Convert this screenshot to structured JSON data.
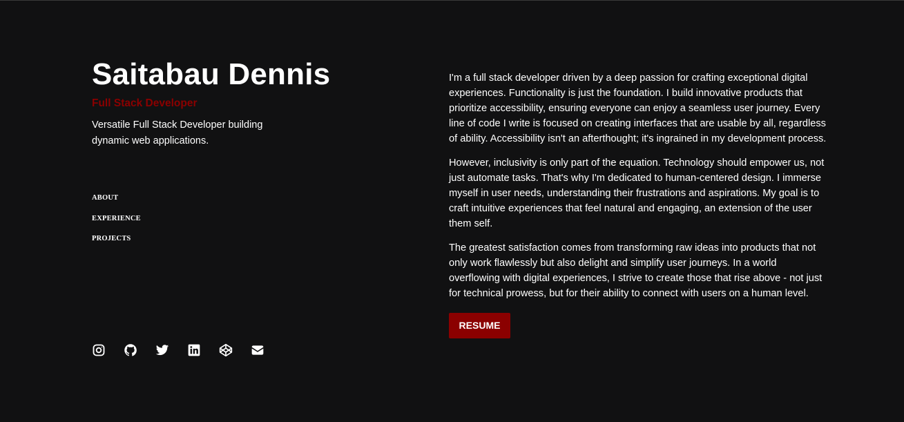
{
  "header": {
    "name": "Saitabau Dennis",
    "role": "Full Stack Developer",
    "tagline": "Versatile Full Stack Developer building dynamic web applications."
  },
  "nav": {
    "items": [
      {
        "label": "ABOUT"
      },
      {
        "label": "EXPERIENCE"
      },
      {
        "label": "PROJECTS"
      }
    ]
  },
  "socials": {
    "icons": [
      "instagram-icon",
      "github-icon",
      "twitter-icon",
      "linkedin-icon",
      "codepen-icon",
      "mail-icon"
    ]
  },
  "about": {
    "paragraphs": [
      "I'm a full stack developer driven by a deep passion for crafting exceptional digital experiences. Functionality is just the foundation. I build innovative products that prioritize accessibility, ensuring everyone can enjoy a seamless user journey. Every line of code I write is focused on creating interfaces that are usable by all, regardless of ability. Accessibility isn't an afterthought; it's ingrained in my development process.",
      "However, inclusivity is only part of the equation. Technology should empower us, not just automate tasks. That's why I'm dedicated to human-centered design. I immerse myself in user needs, understanding their frustrations and aspirations. My goal is to craft intuitive experiences that feel natural and engaging, an extension of the user them self.",
      "The greatest satisfaction comes from transforming raw ideas into products that not only work flawlessly but also delight and simplify user journeys. In a world overflowing with digital experiences, I strive to create those that rise above - not just for technical prowess, but for their ability to connect with users on a human level."
    ],
    "resume_label": "RESUME"
  },
  "colors": {
    "background": "#111112",
    "accent": "#8b0000",
    "text": "#ffffff"
  }
}
